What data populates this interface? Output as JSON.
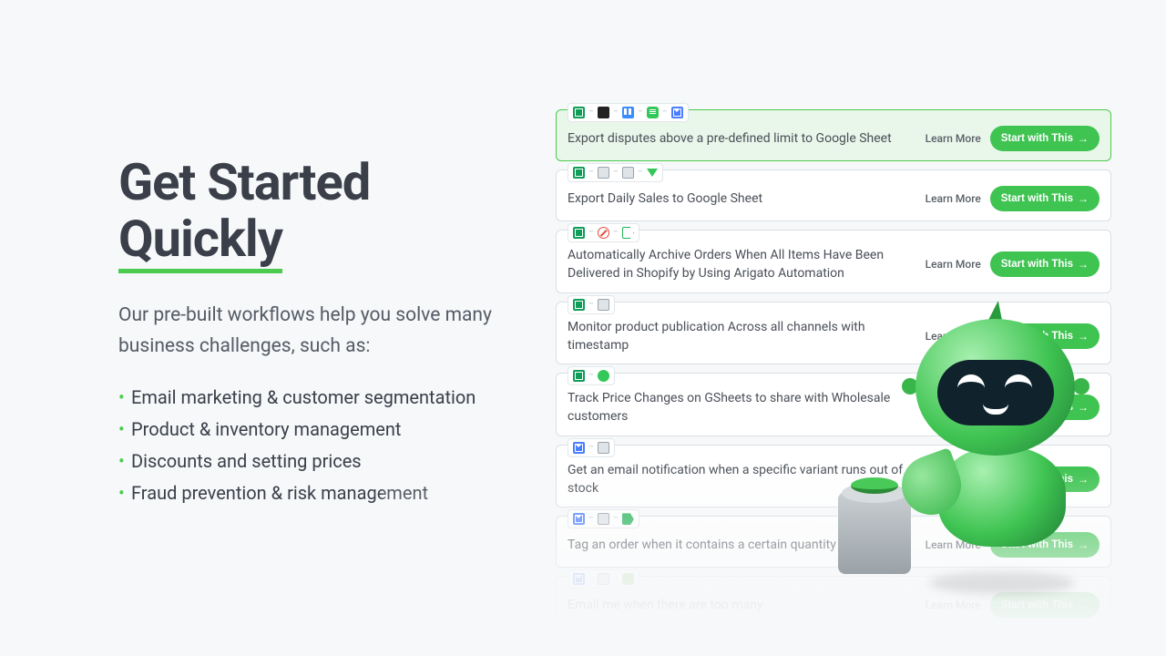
{
  "heading": {
    "line1": "Get Started",
    "line2": "Quickly"
  },
  "subtitle": "Our pre-built workflows help you solve many business challenges, such as:",
  "features": [
    "Email marketing & customer segmentation",
    "Product & inventory management",
    "Discounts and setting prices",
    "Fraud prevention & risk management"
  ],
  "learn_more_label": "Learn More",
  "start_label": "Start with This",
  "cards": [
    {
      "title": "Export disputes above a pre-defined limit to Google Sheet",
      "highlight": true,
      "icons": [
        "sheet",
        "black",
        "trello",
        "sms",
        "mail"
      ]
    },
    {
      "title": "Export Daily Sales to Google Sheet",
      "icons": [
        "sheet",
        "file",
        "file",
        "down"
      ]
    },
    {
      "title": "Automatically Archive Orders When All Items Have Been Delivered in Shopify by Using Arigato Automation",
      "icons": [
        "sheet",
        "block",
        "tag-outline"
      ]
    },
    {
      "title": "Monitor product publication Across all channels with timestamp",
      "icons": [
        "sheet",
        "file"
      ]
    },
    {
      "title": "Track Price Changes on GSheets to share with Wholesale customers",
      "icons": [
        "sheet",
        "user"
      ]
    },
    {
      "title": "Get an email notification when a specific variant runs out of stock",
      "icons": [
        "mail",
        "file"
      ]
    },
    {
      "title": "Tag an order when it contains a certain quantity of an item",
      "icons": [
        "mail",
        "file",
        "tag"
      ]
    },
    {
      "title": "Email me when there are too many",
      "faded": true,
      "icons": [
        "mail",
        "file",
        "bag"
      ]
    }
  ]
}
